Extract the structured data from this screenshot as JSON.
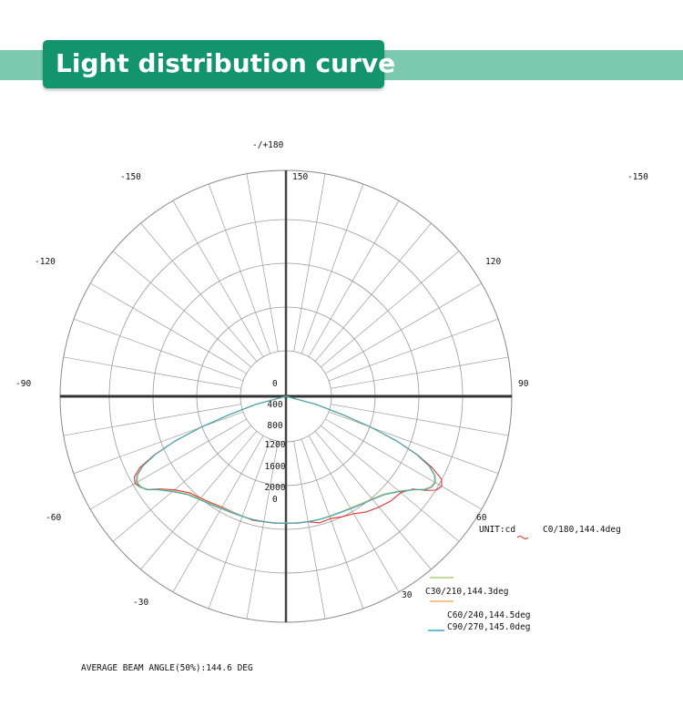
{
  "banner": {
    "title": "Light distribution curve"
  },
  "chart_data": {
    "type": "polar",
    "unit_label": "UNIT:cd",
    "angle_labels": {
      "top": "-/+180",
      "left_150": "-150",
      "center_150": "150",
      "right_150": "-150",
      "left_120": "-120",
      "right_120": "120",
      "left_90": "-90",
      "right_90": "90",
      "left_60": "-60",
      "right_60": "60",
      "left_30": "-30",
      "right_30": "30"
    },
    "radial_ticks": [
      "0",
      "400",
      "800",
      "1200",
      "1600",
      "2000",
      "0"
    ],
    "rmax": 2500,
    "series": [
      {
        "name": "C0/180,144.4deg",
        "color": "#e3302f",
        "angles": [
          -90,
          -75,
          -72,
          -70,
          -68,
          -66,
          -64,
          -62,
          -60,
          -58,
          -56,
          -54,
          -50,
          -45,
          -40,
          -35,
          -30,
          -25,
          -20,
          -15,
          -10,
          -5,
          0,
          5,
          10,
          15,
          20,
          25,
          30,
          35,
          40,
          45,
          50,
          54,
          56,
          58,
          60,
          62,
          64,
          66,
          68,
          70,
          72,
          75,
          90
        ],
        "values": [
          0,
          340,
          660,
          1000,
          1330,
          1600,
          1800,
          1900,
          1930,
          1900,
          1840,
          1740,
          1610,
          1510,
          1470,
          1440,
          1415,
          1410,
          1410,
          1420,
          1410,
          1410,
          1400,
          1410,
          1410,
          1450,
          1440,
          1470,
          1500,
          1560,
          1600,
          1640,
          1660,
          1740,
          1860,
          1960,
          1990,
          1950,
          1800,
          1600,
          1330,
          1000,
          660,
          340,
          0
        ]
      },
      {
        "name": "C30/210,144.3deg",
        "color": "#a9d271",
        "angles": [
          -90,
          -75,
          -72,
          -70,
          -68,
          -66,
          -64,
          -62,
          -60,
          -58,
          -56,
          -54,
          -50,
          -45,
          -40,
          -35,
          -30,
          -25,
          -20,
          -15,
          -10,
          -5,
          0,
          5,
          10,
          15,
          20,
          25,
          30,
          35,
          40,
          45,
          50,
          54,
          56,
          58,
          60,
          62,
          64,
          66,
          68,
          70,
          72,
          75,
          90
        ],
        "values": [
          0,
          340,
          660,
          1000,
          1320,
          1580,
          1760,
          1860,
          1900,
          1890,
          1840,
          1750,
          1630,
          1530,
          1480,
          1450,
          1425,
          1415,
          1410,
          1410,
          1405,
          1405,
          1400,
          1405,
          1405,
          1410,
          1410,
          1415,
          1425,
          1450,
          1480,
          1530,
          1630,
          1750,
          1840,
          1890,
          1900,
          1860,
          1760,
          1580,
          1320,
          1000,
          660,
          340,
          0
        ]
      },
      {
        "name": "C60/240,144.5deg",
        "color": "#f0b25a",
        "angles": [
          -90,
          -75,
          -72,
          -70,
          -68,
          -66,
          -64,
          -62,
          -60,
          -58,
          -56,
          -54,
          -50,
          -45,
          -40,
          -35,
          -30,
          -25,
          -20,
          -15,
          -10,
          -5,
          0,
          5,
          10,
          15,
          20,
          25,
          30,
          35,
          40,
          45,
          50,
          54,
          56,
          58,
          60,
          62,
          64,
          66,
          68,
          70,
          72,
          75,
          90
        ],
        "values": [
          0,
          345,
          665,
          1005,
          1325,
          1585,
          1765,
          1865,
          1905,
          1895,
          1845,
          1755,
          1635,
          1535,
          1485,
          1455,
          1430,
          1420,
          1415,
          1412,
          1408,
          1406,
          1402,
          1406,
          1408,
          1412,
          1415,
          1420,
          1430,
          1455,
          1485,
          1535,
          1635,
          1755,
          1845,
          1895,
          1905,
          1865,
          1765,
          1585,
          1325,
          1005,
          665,
          345,
          0
        ]
      },
      {
        "name": "C90/270,145.0deg",
        "color": "#3aa6c4",
        "angles": [
          -90,
          -75,
          -72,
          -70,
          -68,
          -66,
          -64,
          -62,
          -60,
          -58,
          -56,
          -54,
          -50,
          -45,
          -40,
          -35,
          -30,
          -25,
          -20,
          -15,
          -10,
          -5,
          0,
          5,
          10,
          15,
          20,
          25,
          30,
          35,
          40,
          45,
          50,
          54,
          56,
          58,
          60,
          62,
          64,
          66,
          68,
          70,
          72,
          75,
          90
        ],
        "values": [
          0,
          350,
          670,
          1010,
          1330,
          1590,
          1770,
          1870,
          1910,
          1900,
          1850,
          1760,
          1640,
          1540,
          1490,
          1460,
          1435,
          1420,
          1415,
          1412,
          1410,
          1408,
          1405,
          1408,
          1410,
          1412,
          1415,
          1420,
          1435,
          1460,
          1490,
          1540,
          1640,
          1760,
          1850,
          1900,
          1910,
          1870,
          1770,
          1590,
          1330,
          1010,
          670,
          350,
          0
        ]
      }
    ],
    "annotation": "AVERAGE BEAM ANGLE(50%):144.6 DEG"
  }
}
